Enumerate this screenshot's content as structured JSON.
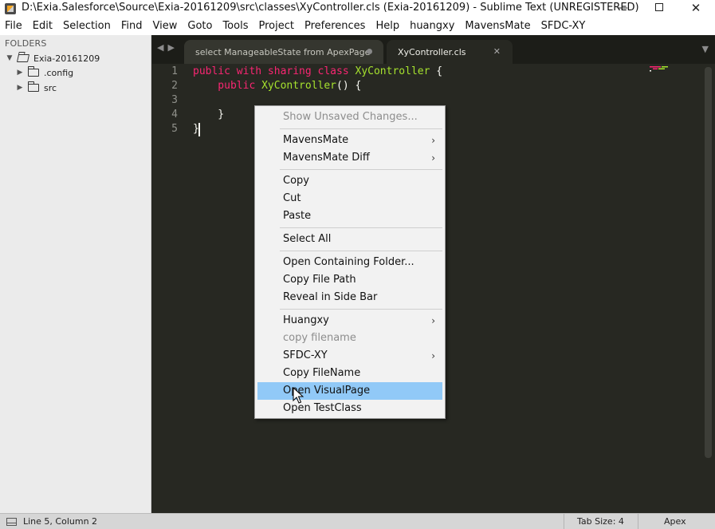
{
  "window": {
    "title": "D:\\Exia.Salesforce\\Source\\Exia-20161209\\src\\classes\\XyController.cls (Exia-20161209) - Sublime Text (UNREGISTERED)",
    "minimize_icon": "minimize-icon",
    "maximize_icon": "maximize-icon",
    "close_glyph": "✕"
  },
  "menubar": [
    "File",
    "Edit",
    "Selection",
    "Find",
    "View",
    "Goto",
    "Tools",
    "Project",
    "Preferences",
    "Help",
    "huangxy",
    "MavensMate",
    "SFDC-XY"
  ],
  "sidebar": {
    "header": "FOLDERS",
    "root": "Exia-20161209",
    "children": [
      ".config",
      "src"
    ]
  },
  "tabs": [
    {
      "label": "select ManageableState from ApexPage",
      "state": "modified"
    },
    {
      "label": "XyController.cls",
      "state": "active"
    }
  ],
  "editor": {
    "line_numbers": [
      "1",
      "2",
      "3",
      "4",
      "5"
    ],
    "lines": [
      [
        {
          "t": "public with sharing class ",
          "c": "kw"
        },
        {
          "t": "XyController",
          "c": "cls"
        },
        {
          "t": " {",
          "c": ""
        }
      ],
      [
        {
          "t": "    public ",
          "c": "kw"
        },
        {
          "t": "XyController",
          "c": "cls"
        },
        {
          "t": "() {",
          "c": ""
        }
      ],
      [],
      [
        {
          "t": "    }",
          "c": ""
        }
      ],
      [
        {
          "t": "}",
          "c": ""
        }
      ]
    ]
  },
  "context_menu": {
    "items": [
      {
        "label": "Show Unsaved Changes...",
        "disabled": true
      },
      {
        "sep": true
      },
      {
        "label": "MavensMate",
        "submenu": true
      },
      {
        "label": "MavensMate Diff",
        "submenu": true
      },
      {
        "sep": true
      },
      {
        "label": "Copy"
      },
      {
        "label": "Cut"
      },
      {
        "label": "Paste"
      },
      {
        "sep": true
      },
      {
        "label": "Select All"
      },
      {
        "sep": true
      },
      {
        "label": "Open Containing Folder..."
      },
      {
        "label": "Copy File Path"
      },
      {
        "label": "Reveal in Side Bar"
      },
      {
        "sep": true
      },
      {
        "label": "Huangxy",
        "submenu": true
      },
      {
        "label": "copy filename",
        "disabled": true
      },
      {
        "label": "SFDC-XY",
        "submenu": true
      },
      {
        "label": "Copy FileName"
      },
      {
        "label": "Open VisualPage",
        "highlight": true
      },
      {
        "label": "Open TestClass"
      }
    ]
  },
  "statusbar": {
    "position": "Line 5, Column 2",
    "tab_size": "Tab Size: 4",
    "syntax": "Apex"
  },
  "colors": {
    "keyword": "#f92672",
    "class_name": "#a6e22e",
    "editor_bg": "#272822",
    "menu_highlight": "#91c9f7"
  }
}
